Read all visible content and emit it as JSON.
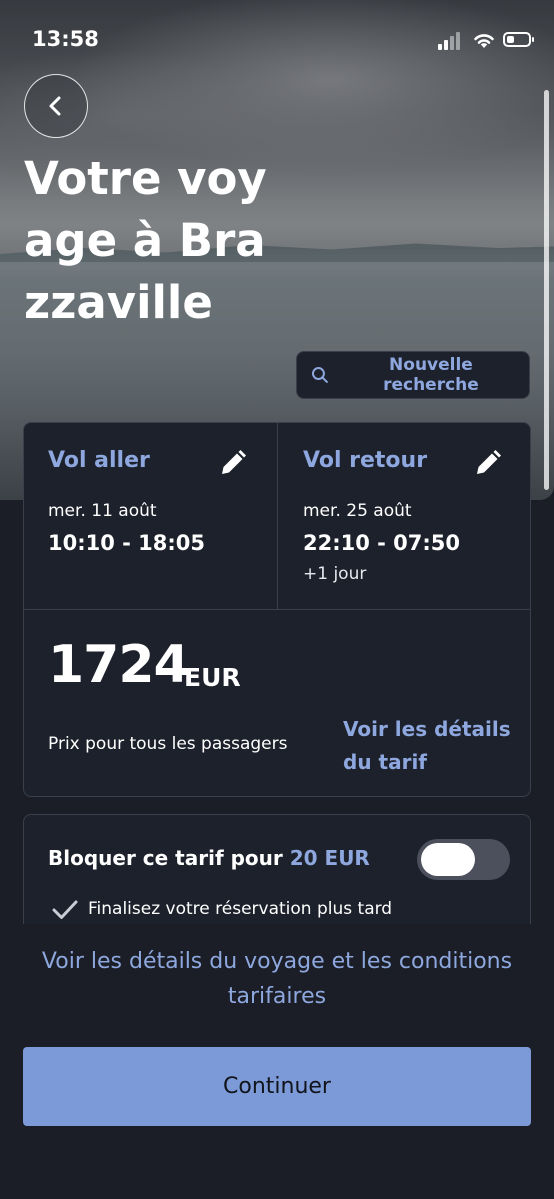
{
  "status_bar": {
    "time": "13:58"
  },
  "header": {
    "title": "Votre voyage à Brazzaville",
    "new_search_label": "Nouvelle recherche"
  },
  "flights": {
    "outbound": {
      "label": "Vol aller",
      "date": "mer. 11 août",
      "times": "10:10 - 18:05"
    },
    "return": {
      "label": "Vol retour",
      "date": "mer. 25 août",
      "times": "22:10 - 07:50",
      "note": "+1 jour"
    }
  },
  "price": {
    "amount": "1724",
    "currency": "EUR",
    "description": "Prix pour tous les passagers",
    "details_link": "Voir les détails du tarif"
  },
  "hold_fare": {
    "label": "Bloquer ce tarif pour",
    "price": "20 EUR",
    "benefit": "Finalisez votre réservation plus tard",
    "enabled": false
  },
  "footer": {
    "trip_details_link": "Voir les détails du voyage et les conditions tarifaires",
    "continue_label": "Continuer"
  },
  "colors": {
    "accent": "#8ea8df",
    "button": "#7b9ad7",
    "card": "#1d212b",
    "background": "#1b1e26"
  },
  "icons": [
    "back-arrow-icon",
    "search-icon",
    "pencil-icon",
    "checkmark-icon",
    "signal-icon",
    "wifi-icon",
    "battery-icon"
  ]
}
